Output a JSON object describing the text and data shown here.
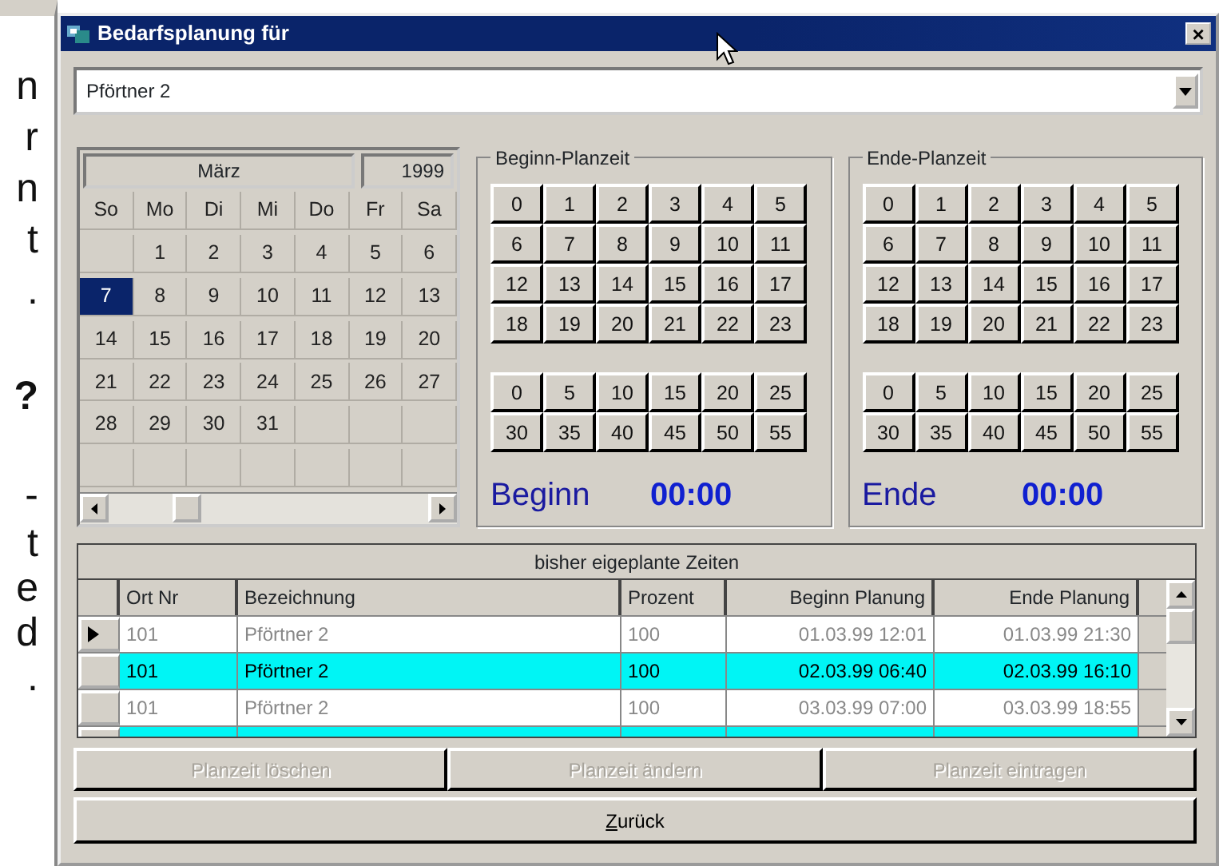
{
  "background_text": [
    "n",
    "r",
    "n",
    "t",
    ".",
    "?",
    "-",
    "t",
    "e",
    "d",
    "."
  ],
  "window": {
    "title": "Bedarfsplanung für",
    "close": "×"
  },
  "employee_select": {
    "value": "Pförtner 2"
  },
  "calendar": {
    "month": "März",
    "year": "1999",
    "weekdays": [
      "So",
      "Mo",
      "Di",
      "Mi",
      "Do",
      "Fr",
      "Sa"
    ],
    "weeks": [
      [
        {
          "day": "1",
          "selected": false
        },
        {
          "day": "2",
          "selected": false
        },
        {
          "day": "3",
          "selected": false
        },
        {
          "day": "4",
          "selected": false
        },
        {
          "day": "5",
          "selected": false
        },
        {
          "day": "6",
          "selected": false
        }
      ],
      [
        {
          "day": "7",
          "selected": true
        },
        {
          "day": "8",
          "selected": false
        },
        {
          "day": "9",
          "selected": false
        },
        {
          "day": "10",
          "selected": false
        },
        {
          "day": "11",
          "selected": false
        },
        {
          "day": "12",
          "selected": false
        },
        {
          "day": "13",
          "selected": false
        }
      ],
      [
        {
          "day": "14",
          "selected": false
        },
        {
          "day": "15",
          "selected": false
        },
        {
          "day": "16",
          "selected": false
        },
        {
          "day": "17",
          "selected": false
        },
        {
          "day": "18",
          "selected": false
        },
        {
          "day": "19",
          "selected": false
        },
        {
          "day": "20",
          "selected": false
        }
      ],
      [
        {
          "day": "21",
          "selected": false
        },
        {
          "day": "22",
          "selected": false
        },
        {
          "day": "23",
          "selected": false
        },
        {
          "day": "24",
          "selected": false
        },
        {
          "day": "25",
          "selected": false
        },
        {
          "day": "26",
          "selected": false
        },
        {
          "day": "27",
          "selected": false
        }
      ],
      [
        {
          "day": "28",
          "selected": false
        },
        {
          "day": "29",
          "selected": false
        },
        {
          "day": "30",
          "selected": false
        },
        {
          "day": "31",
          "selected": false
        }
      ]
    ]
  },
  "time_groups": [
    {
      "title": "Beginn-Planzeit",
      "hours": [
        "0",
        "1",
        "2",
        "3",
        "4",
        "5",
        "6",
        "7",
        "8",
        "9",
        "10",
        "11",
        "12",
        "13",
        "14",
        "15",
        "16",
        "17",
        "18",
        "19",
        "20",
        "21",
        "22",
        "23"
      ],
      "minutes": [
        "0",
        "5",
        "10",
        "15",
        "20",
        "25",
        "30",
        "35",
        "40",
        "45",
        "50",
        "55"
      ],
      "label": "Beginn",
      "time": "00:00"
    },
    {
      "title": "Ende-Planzeit",
      "hours": [
        "0",
        "1",
        "2",
        "3",
        "4",
        "5",
        "6",
        "7",
        "8",
        "9",
        "10",
        "11",
        "12",
        "13",
        "14",
        "15",
        "16",
        "17",
        "18",
        "19",
        "20",
        "21",
        "22",
        "23"
      ],
      "minutes": [
        "0",
        "5",
        "10",
        "15",
        "20",
        "25",
        "30",
        "35",
        "40",
        "45",
        "50",
        "55"
      ],
      "label": "Ende",
      "time": "00:00"
    }
  ],
  "table": {
    "title": "bisher eigeplante Zeiten",
    "columns": [
      "Ort Nr",
      "Bezeichnung",
      "Prozent",
      "Beginn Planung",
      "Ende Planung"
    ],
    "rows": [
      {
        "current": true,
        "highlighted": false,
        "cells": [
          "101",
          "Pförtner 2",
          "100",
          "01.03.99 12:01",
          "01.03.99 21:30"
        ]
      },
      {
        "current": false,
        "highlighted": true,
        "cells": [
          "101",
          "Pförtner 2",
          "100",
          "02.03.99 06:40",
          "02.03.99 16:10"
        ]
      },
      {
        "current": false,
        "highlighted": false,
        "cells": [
          "101",
          "Pförtner 2",
          "100",
          "03.03.99 07:00",
          "03.03.99 18:55"
        ]
      },
      {
        "current": false,
        "highlighted": true
      }
    ]
  },
  "buttons": [
    {
      "label": "Planzeit löschen",
      "disabled": true
    },
    {
      "label": "Planzeit ändern",
      "disabled": true
    },
    {
      "label": "Planzeit eintragen",
      "disabled": true
    }
  ],
  "back_button": {
    "label": "Zurück",
    "disabled": false
  }
}
